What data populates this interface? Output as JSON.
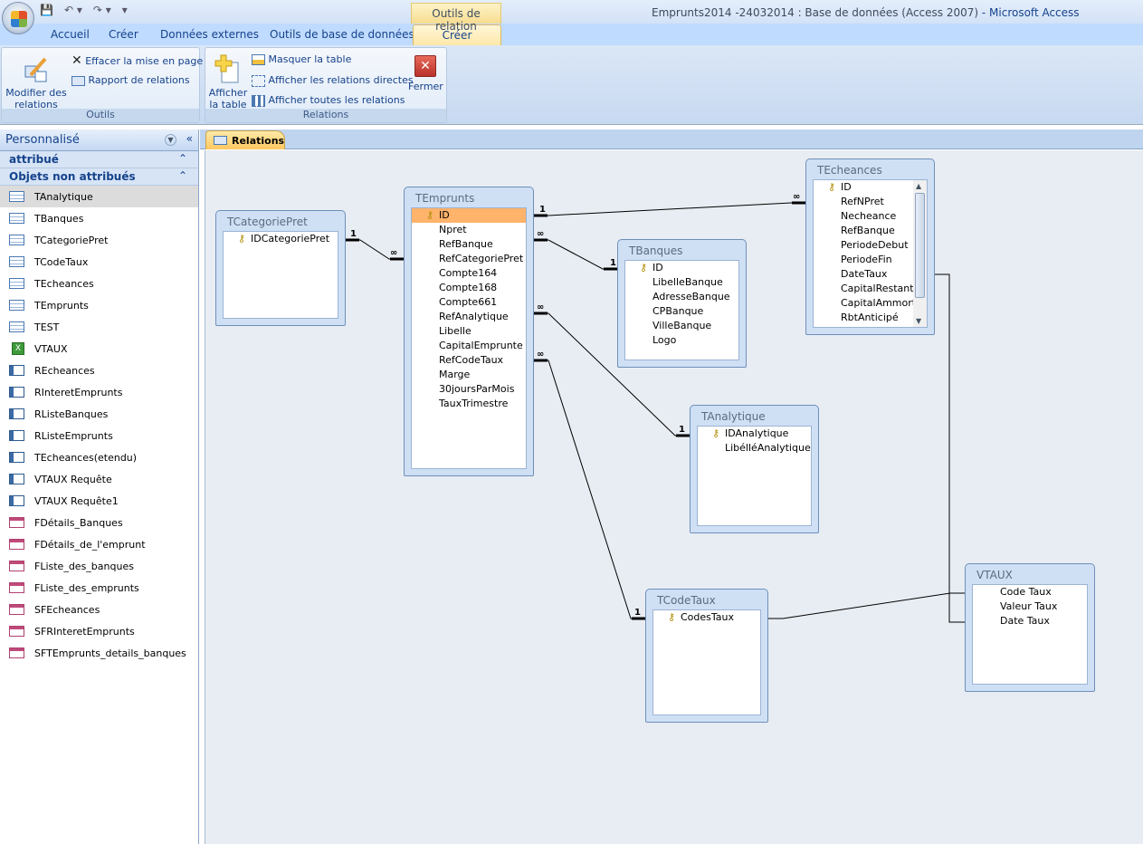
{
  "window": {
    "title": "Emprunts2014 -24032014 : Base de données (Access 2007)",
    "app": " - Microsoft Access",
    "context_tab_group": "Outils de relation"
  },
  "qat": {
    "save_icon": "💾",
    "undo_icon": "↶ ▾",
    "redo_icon": "↷ ▾",
    "customize_icon": "▾"
  },
  "ribbon_tabs": [
    "Accueil",
    "Créer",
    "Données externes",
    "Outils de base de données"
  ],
  "active_tab": "Créer",
  "ribbon": {
    "outils": {
      "label": "Outils",
      "modifier": "Modifier des",
      "modifier2": "relations",
      "effacer": "Effacer la mise en page",
      "rapport": "Rapport de relations"
    },
    "relations": {
      "label": "Relations",
      "afficher": "Afficher",
      "afficher2": "la table",
      "masquer": "Masquer la table",
      "directes": "Afficher les relations directes",
      "toutes": "Afficher toutes les relations",
      "fermer": "Fermer"
    }
  },
  "nav": {
    "title": "Personnalisé",
    "groups": [
      "attribué",
      "Objets non attribués"
    ],
    "items": [
      {
        "label": "TAnalytique",
        "icon": "table",
        "selected": true
      },
      {
        "label": "TBanques",
        "icon": "table"
      },
      {
        "label": "TCategoriePret",
        "icon": "table"
      },
      {
        "label": "TCodeTaux",
        "icon": "table"
      },
      {
        "label": "TEcheances",
        "icon": "table"
      },
      {
        "label": "TEmprunts",
        "icon": "table"
      },
      {
        "label": "TEST",
        "icon": "table"
      },
      {
        "label": "VTAUX",
        "icon": "xl"
      },
      {
        "label": "REcheances",
        "icon": "query"
      },
      {
        "label": "RInteretEmprunts",
        "icon": "query"
      },
      {
        "label": "RListeBanques",
        "icon": "query"
      },
      {
        "label": "RListeEmprunts",
        "icon": "query"
      },
      {
        "label": "TEcheances(etendu)",
        "icon": "query"
      },
      {
        "label": "VTAUX Requête",
        "icon": "query"
      },
      {
        "label": "VTAUX Requête1",
        "icon": "query"
      },
      {
        "label": "FDétails_Banques",
        "icon": "form"
      },
      {
        "label": "FDétails_de_l'emprunt",
        "icon": "form"
      },
      {
        "label": "FListe_des_banques",
        "icon": "form"
      },
      {
        "label": "FListe_des_emprunts",
        "icon": "form"
      },
      {
        "label": "SFEcheances",
        "icon": "form"
      },
      {
        "label": "SFRInteretEmprunts",
        "icon": "form"
      },
      {
        "label": "SFTEmprunts_details_banques",
        "icon": "form"
      }
    ]
  },
  "document_tab": "Relations",
  "tables": {
    "TCategoriePret": {
      "title": "TCategoriePret",
      "fields": [
        "IDCategoriePret"
      ],
      "keys": [
        0
      ]
    },
    "TEmprunts": {
      "title": "TEmprunts",
      "fields": [
        "ID",
        "Npret",
        "RefBanque",
        "RefCategoriePret",
        "Compte164",
        "Compte168",
        "Compte661",
        "RefAnalytique",
        "Libelle",
        "CapitalEmprunte",
        "RefCodeTaux",
        "Marge",
        "30joursParMois",
        "TauxTrimestre"
      ],
      "keys": [
        0
      ],
      "selected": 0
    },
    "TBanques": {
      "title": "TBanques",
      "fields": [
        "ID",
        "LibelleBanque",
        "AdresseBanque",
        "CPBanque",
        "VilleBanque",
        "Logo"
      ],
      "keys": [
        0
      ]
    },
    "TEcheances": {
      "title": "TEcheances",
      "fields": [
        "ID",
        "RefNPret",
        "Necheance",
        "RefBanque",
        "PeriodeDebut",
        "PeriodeFin",
        "DateTaux",
        "CapitalRestantD",
        "CapitalAmmorti",
        "RbtAnticipé"
      ],
      "keys": [
        0
      ],
      "scrollbar": true
    },
    "TAnalytique": {
      "title": "TAnalytique",
      "fields": [
        "IDAnalytique",
        "LibélléAnalytique"
      ],
      "keys": [
        0
      ]
    },
    "TCodeTaux": {
      "title": "TCodeTaux",
      "fields": [
        "CodesTaux"
      ],
      "keys": [
        0
      ]
    },
    "VTAUX": {
      "title": "VTAUX",
      "fields": [
        "Code Taux",
        "Valeur Taux",
        "Date Taux"
      ],
      "keys": []
    }
  },
  "relationships": [
    {
      "from": "TCategoriePret.IDCategoriePret",
      "to": "TEmprunts.RefCategoriePret",
      "one": "1",
      "many": "∞"
    },
    {
      "from": "TEmprunts.ID",
      "to": "TEcheances.RefNPret",
      "one": "1",
      "many": "∞"
    },
    {
      "from": "TBanques.ID",
      "to": "TEmprunts.RefBanque",
      "one": "1",
      "many": "∞"
    },
    {
      "from": "TAnalytique.IDAnalytique",
      "to": "TEmprunts.RefAnalytique",
      "one": "1",
      "many": "∞"
    },
    {
      "from": "TCodeTaux.CodesTaux",
      "to": "TEmprunts.RefCodeTaux",
      "one": "1",
      "many": "∞"
    },
    {
      "from": "TCodeTaux.CodesTaux",
      "to": "VTAUX.Code Taux"
    },
    {
      "from": "TEcheances.DateTaux",
      "to": "VTAUX.Date Taux"
    }
  ]
}
